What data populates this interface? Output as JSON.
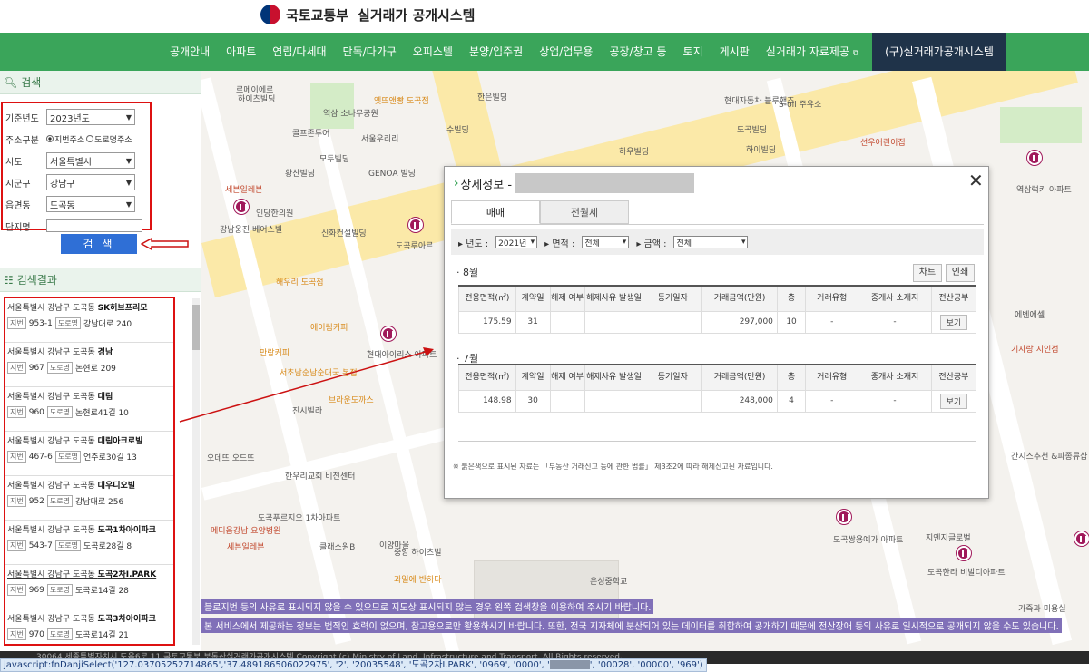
{
  "header": {
    "ministry": "국토교통부",
    "title": "실거래가 공개시스템"
  },
  "nav": {
    "items": [
      "공개안내",
      "아파트",
      "연립/다세대",
      "단독/다가구",
      "오피스텔",
      "분양/입주권",
      "상업/업무용",
      "공장/창고 등",
      "토지",
      "게시판",
      "실거래가 자료제공"
    ],
    "highlight": "(구)실거래가공개시스템"
  },
  "search": {
    "section_title": "검색",
    "year_label": "기준년도",
    "year_value": "2023년도",
    "addr_type_label": "주소구분",
    "addr_type_opt1": "지번주소",
    "addr_type_opt2": "도로명주소",
    "sido_label": "시도",
    "sido_value": "서울특별시",
    "sigungu_label": "시군구",
    "sigungu_value": "강남구",
    "dong_label": "읍면동",
    "dong_value": "도곡동",
    "complex_label": "단지명",
    "complex_value": "",
    "button_label": "검 색"
  },
  "results": {
    "section_title": "검색결과",
    "jibun_tag": "지번",
    "road_tag": "도로명",
    "items": [
      {
        "prefix": "서울특별시 강남구 도곡동 ",
        "name": "SK허브프리모",
        "jibun": "953-1",
        "road": "강남대로 240"
      },
      {
        "prefix": "서울특별시 강남구 도곡동 ",
        "name": "경남",
        "jibun": "967",
        "road": "논현로 209"
      },
      {
        "prefix": "서울특별시 강남구 도곡동 ",
        "name": "대림",
        "jibun": "960",
        "road": "논현로41길 10"
      },
      {
        "prefix": "서울특별시 강남구 도곡동 ",
        "name": "대림아크로빌",
        "jibun": "467-6",
        "road": "언주로30길 13"
      },
      {
        "prefix": "서울특별시 강남구 도곡동 ",
        "name": "대우디오빌",
        "jibun": "952",
        "road": "강남대로 256"
      },
      {
        "prefix": "서울특별시 강남구 도곡동 ",
        "name": "도곡1차아이파크",
        "jibun": "543-7",
        "road": "도곡로28길 8"
      },
      {
        "prefix": "서울특별시 강남구 도곡동 ",
        "name": "도곡2차I.PARK",
        "jibun": "969",
        "road": "도곡로14길 28"
      },
      {
        "prefix": "서울특별시 강남구 도곡동 ",
        "name": "도곡3차아이파크",
        "jibun": "970",
        "road": "도곡로14길 21"
      }
    ]
  },
  "map": {
    "labels": {
      "l1": "르메이에르",
      "l2": "하이츠빌딩",
      "l3": "역삼 소나무공원",
      "l4": "골프존투어",
      "l5": "서울우리리",
      "l6": "모두빌딩",
      "l7": "황산빌딩",
      "l8": "GENOA 빌딩",
      "l9": "세븐일레븐",
      "l10": "인당한의원",
      "l11": "강남웅진 베어스빌",
      "l12": "신화컨설빌딩",
      "l13": "도곡루아르",
      "l14": "해우리 도곡점",
      "l15": "에이림커피",
      "l16": "현대아이리스 아파트",
      "l17": "만랑커피",
      "l18": "서초남순남순대국 본점",
      "l19": "브라운도까스",
      "l20": "진시빌라",
      "l21": "오데뜨 오드뜨",
      "l22": "한우리교회 비전센터",
      "l23": "메디움강남 요양병원",
      "l24": "도곡푸르지오 1차아파트",
      "l25": "클래스원B",
      "l26": "이양마을",
      "l27": "중앙 하이츠빌",
      "l28": "은성중학교",
      "l29": "한은빌딩",
      "l30": "현대자동차 블루핸즈",
      "l31": "S-oil 주유소",
      "l32": "선우어린이집",
      "l33": "도곡빌딩",
      "l34": "역삼럭키 아파트",
      "l35": "세븐일레븐",
      "l36": "도곡쌍용예가 아파트",
      "l37": "도곡한라 비발디아파트",
      "l38": "지엔지글로벌",
      "l39": "과일에 반하다",
      "l40": "수빌딩",
      "l41": "하우빌딩",
      "l42": "에벤에셀",
      "l43": "기사랑 지인점",
      "l44": "간지스추천 &파종류샵",
      "l45": "가죽과 미용실",
      "l46": "엣뜨앤빵 도곡점",
      "l47": "하이빌딩"
    },
    "notice1": "블로지번 등의 사유로 표시되지 않을 수 있으므로 지도상 표시되지 않는 경우 왼쪽 검색창을 이용하여 주시기 바랍니다.",
    "notice2": "본 서비스에서 제공하는 정보는 법적인 효력이 없으며, 참고용으로만 활용하시기 바랍니다. 또한, 전국 지자체에 분산되어 있는 데이터를 취합하여 공개하기 때문에 전산장애 등의 사유로 일시적으로 공개되지 않을 수도 있습니다.",
    "scale": "30m",
    "brand": "kakao"
  },
  "popup": {
    "title": "상세정보 -",
    "tab_sale": "매매",
    "tab_rent": "전월세",
    "filter_year_label": "년도 :",
    "filter_year_value": "2021년",
    "filter_area_label": "면적 :",
    "filter_area_value": "전체",
    "filter_price_label": "금액 :",
    "filter_price_value": "전체",
    "chart_btn": "차트",
    "print_btn": "인쇄",
    "columns": [
      "전용면적(㎡)",
      "계약일",
      "해제 여부",
      "해제사유 발생일",
      "등기일자",
      "거래금액(만원)",
      "층",
      "거래유형",
      "중개사 소재지",
      "전산공부"
    ],
    "months": [
      {
        "label": "8월",
        "row": {
          "area": "175.59",
          "day": "31",
          "cancel": "",
          "cancel_date": "",
          "reg_date": "",
          "price": "297,000",
          "floor": "10",
          "type": "-",
          "agent": "-",
          "doc": "보기"
        }
      },
      {
        "label": "7월",
        "row": {
          "area": "148.98",
          "day": "30",
          "cancel": "",
          "cancel_date": "",
          "reg_date": "",
          "price": "248,000",
          "floor": "4",
          "type": "-",
          "agent": "-",
          "doc": "보기"
        }
      }
    ],
    "footnote": "※ 붉은색으로 표시된 자료는 「부동산 거래신고 등에 관한 법률」 제3조2에 따라 해제신고된 자료입니다."
  },
  "footer": {
    "text": "30064 세종특별자치시 도움6로 11 국토교통부 부동산실거래가공개시스템  Copyright (c) Ministry of Land, Infrastructure and Transport. All Rights reserved."
  },
  "status": {
    "text_before": "javascript:fnDanjiSelect('127.03705252714865','37.489186506022975', '2', '20035548', '도곡2차I.PARK', '0969', '0000', '",
    "text_after": "', '00028', '00000', '969')"
  }
}
